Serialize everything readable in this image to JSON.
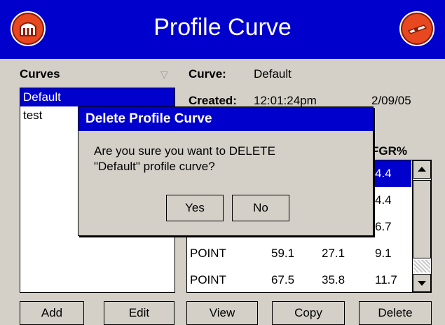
{
  "header": {
    "title": "Profile Curve",
    "home_icon": "home-icon",
    "exit_icon": "exit-icon",
    "accent": "#0000cc",
    "button_color": "#e8481f"
  },
  "curves_panel": {
    "label": "Curves",
    "items": [
      "Default",
      "test"
    ],
    "selected_index": 0
  },
  "detail": {
    "curve_label": "Curve:",
    "curve_value": "Default",
    "created_label": "Created:",
    "created_value": "12:01:24pm",
    "created_date": "2/09/05",
    "column_header": "FGR%",
    "rows": [
      {
        "type": "",
        "a": "",
        "b": "",
        "fgr": "4.4"
      },
      {
        "type": "",
        "a": "",
        "b": "",
        "fgr": "4.4"
      },
      {
        "type": "",
        "a": "",
        "b": "",
        "fgr": "6.7"
      },
      {
        "type": "POINT",
        "a": "59.1",
        "b": "27.1",
        "fgr": "9.1"
      },
      {
        "type": "POINT",
        "a": "67.5",
        "b": "35.8",
        "fgr": "11.7"
      }
    ]
  },
  "buttons": {
    "add": "Add",
    "edit": "Edit",
    "view": "View",
    "copy": "Copy",
    "delete": "Delete"
  },
  "dialog": {
    "title": "Delete Profile Curve",
    "line1": "Are you sure you want to DELETE",
    "line2": "\"Default\" profile curve?",
    "yes": "Yes",
    "no": "No"
  }
}
